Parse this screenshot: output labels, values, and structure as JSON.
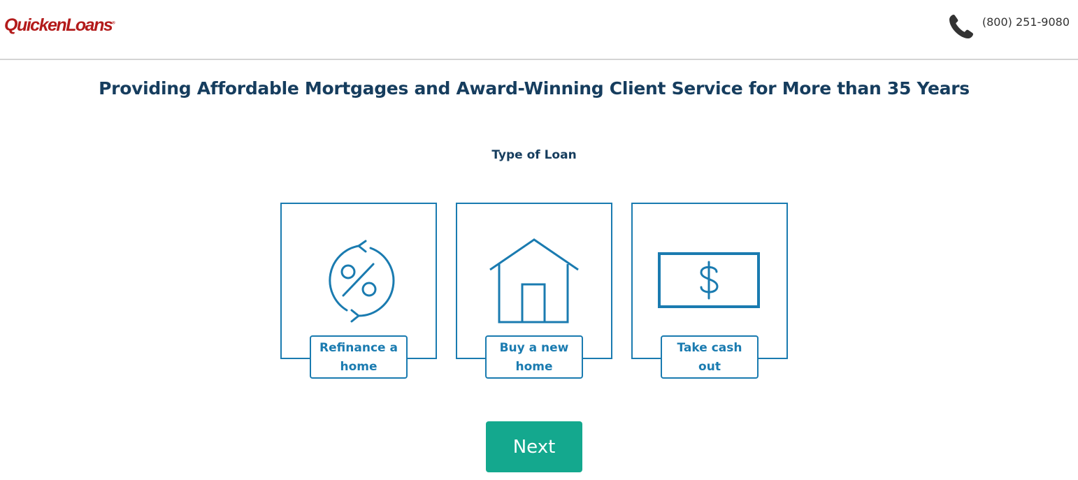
{
  "header": {
    "logo_text": "QuickenLoans",
    "logo_mark": "®",
    "phone_icon": "phone-icon",
    "phone_number": "(800) 251-9080"
  },
  "main": {
    "title": "Providing Affordable Mortgages and Award-Winning Client Service for More than 35 Years",
    "section_label": "Type of Loan",
    "options": [
      {
        "label": "Refinance a home",
        "icon": "refinance-percent-icon"
      },
      {
        "label": "Buy a new home",
        "icon": "house-icon"
      },
      {
        "label": "Take cash out",
        "icon": "cash-bill-icon"
      }
    ],
    "next_label": "Next"
  },
  "colors": {
    "brand_red": "#b31b1b",
    "title_navy": "#163d5e",
    "accent_blue": "#1a7bb0",
    "button_green": "#14a88e",
    "divider_gray": "#d4d4d4"
  }
}
